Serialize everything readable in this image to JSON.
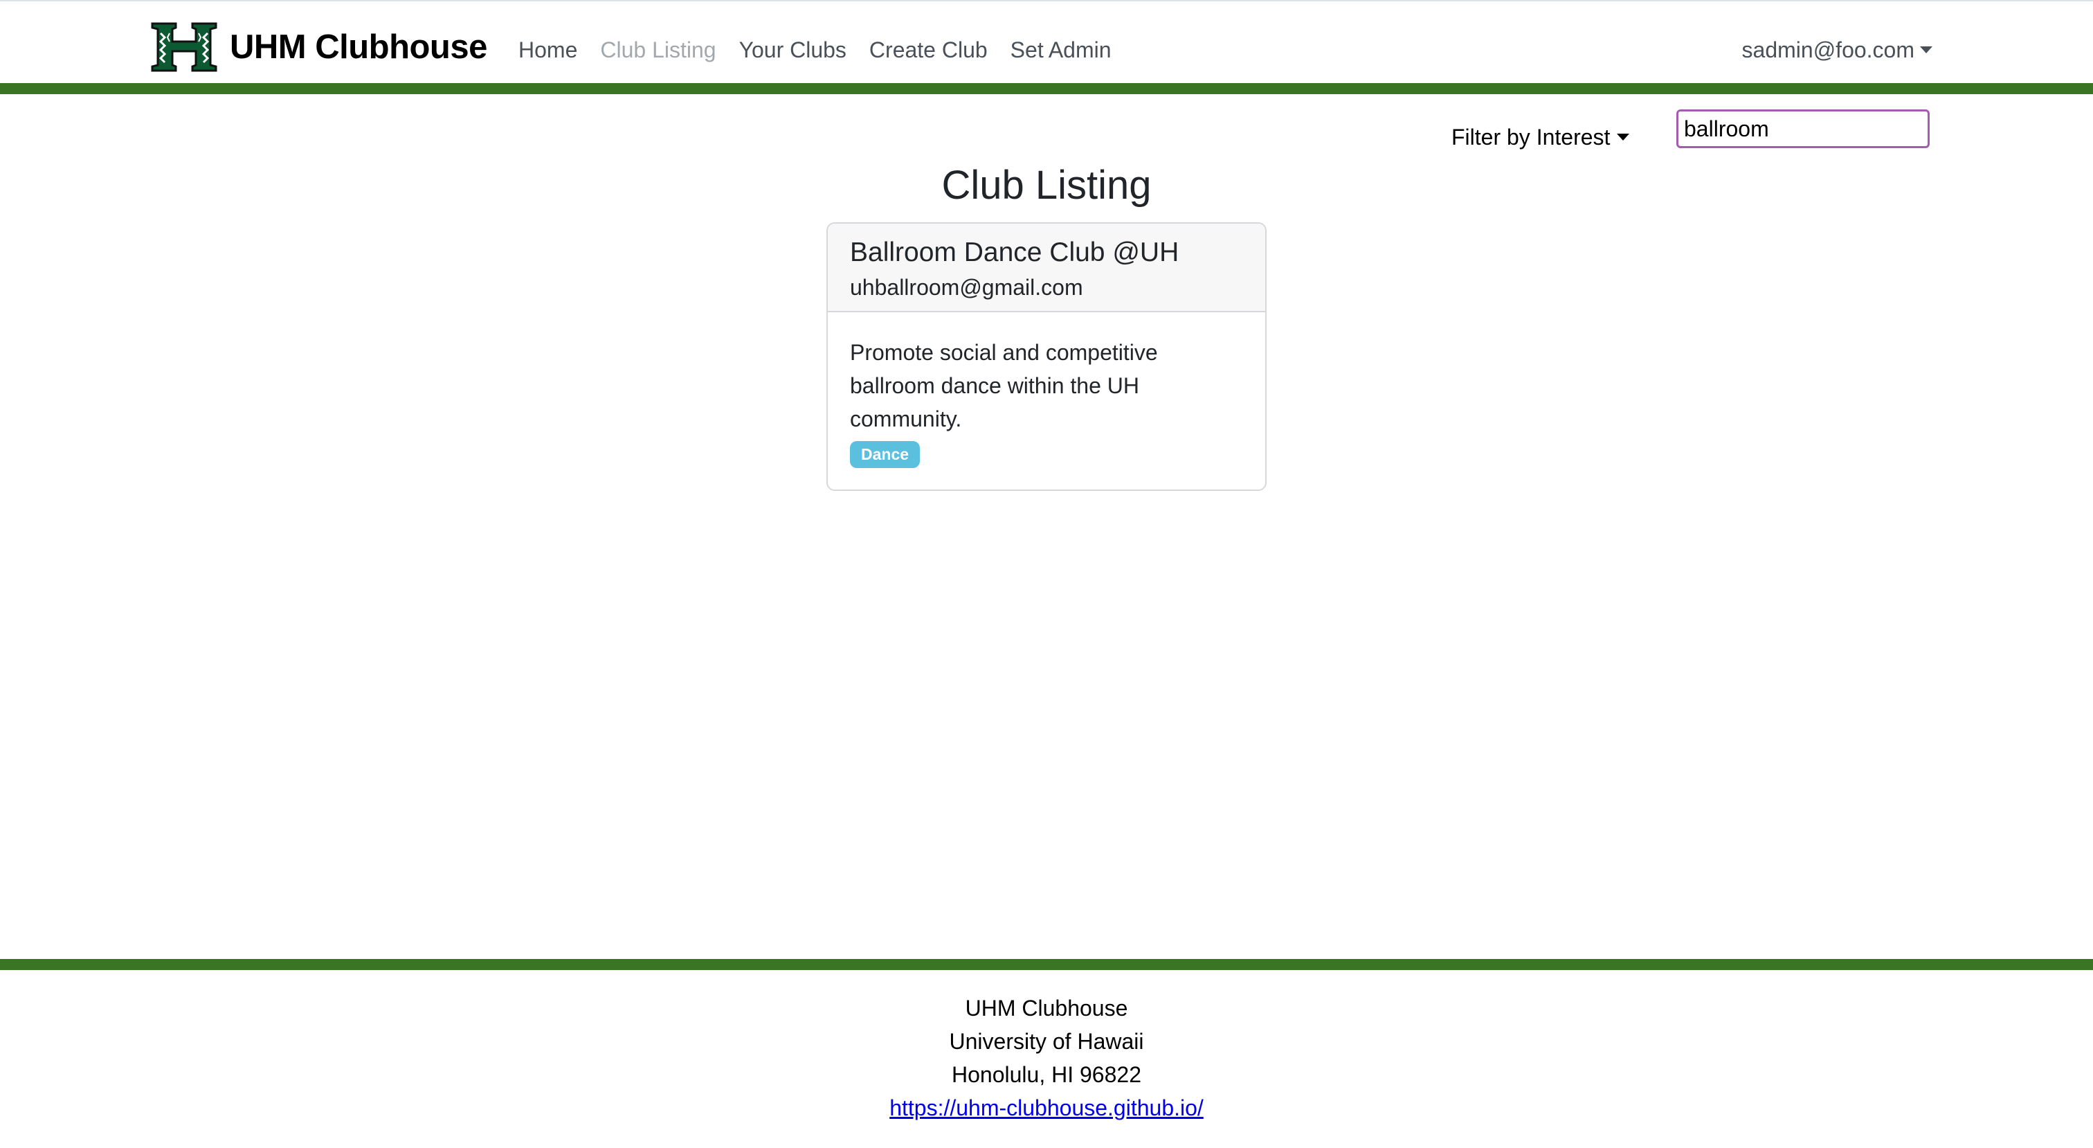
{
  "navbar": {
    "brand": "UHM Clubhouse",
    "brand_logo": "uh-h-logo-icon",
    "links": [
      {
        "label": "Home",
        "active": false
      },
      {
        "label": "Club Listing",
        "active": true
      },
      {
        "label": "Your Clubs",
        "active": false
      },
      {
        "label": "Create Club",
        "active": false
      },
      {
        "label": "Set Admin",
        "active": false
      }
    ],
    "user": "sadmin@foo.com",
    "accent_color": "#3a7524"
  },
  "toolbar": {
    "filter_label": "Filter by Interest",
    "search_value": "ballroom"
  },
  "main": {
    "title": "Club Listing",
    "clubs": [
      {
        "name": "Ballroom Dance Club @UH",
        "email": "uhballroom@gmail.com",
        "description": "Promote social and competitive ballroom dance within the UH community.",
        "tags": [
          "Dance"
        ],
        "tag_color": "#5bc0de"
      }
    ]
  },
  "footer": {
    "line1": "UHM Clubhouse",
    "line2": "University of Hawaii",
    "line3": "Honolulu, HI 96822",
    "link": "https://uhm-clubhouse.github.io/"
  }
}
